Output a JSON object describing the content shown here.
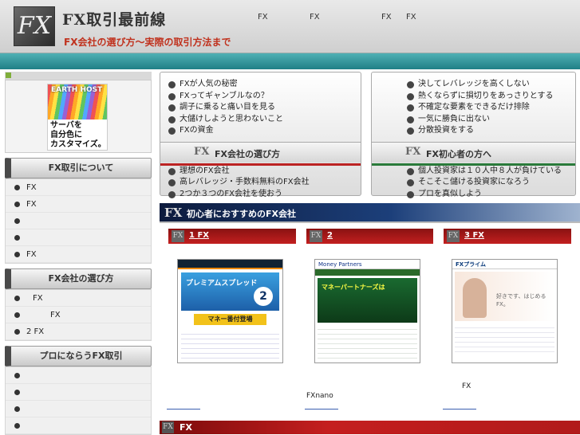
{
  "header": {
    "logo_mark": "FX",
    "title": "FX取引最前線",
    "subtitle": "FX会社の選び方〜実際の取引方法まで",
    "nav": [
      "FX",
      "FX",
      "FX",
      "FX"
    ]
  },
  "sidebar": {
    "ad": {
      "brand": "EARTH HOST",
      "line1": "サーバを",
      "line2": "自分色に",
      "line3": "カスタマイズ。"
    },
    "sections": [
      {
        "title": "FX取引について",
        "items": [
          "FX",
          "FX",
          "",
          "",
          "FX"
        ]
      },
      {
        "title": "FX会社の選び方",
        "items": [
          "FX",
          "FX",
          "2 FX"
        ]
      },
      {
        "title": "プロにならうFX取引",
        "items": [
          "",
          "",
          "",
          ""
        ]
      }
    ]
  },
  "box_left": {
    "top_items": [
      "FXが人気の秘密",
      "FXってギャンブルなの？",
      "調子に乗ると痛い目を見る",
      "大儲けしようと思わないこと",
      "FXの資金"
    ],
    "band_title": "FX会社の選び方",
    "bottom_items": [
      "理想のFX会社",
      "高レバレッジ・手数料無料のFX会社",
      "2つか３つのFX会社を使おう"
    ]
  },
  "box_right": {
    "top_items": [
      "決してレバレッジを高くしない",
      "熱くならずに損切りをあっさりとする",
      "不確定な要素をできるだけ排除",
      "一気に勝負に出ない",
      "分散投資をする"
    ],
    "band_title": "FX初心者の方へ",
    "bottom_items": [
      "個人投資家は１０人中８人が負けている",
      "そこそこ儲ける投資家になろう",
      "プロを真似しよう"
    ]
  },
  "recommend": {
    "title": "初心者におすすめのFX会社",
    "ranks": [
      {
        "label": "1 FX",
        "caption": ""
      },
      {
        "label": "2",
        "caption": "FXnano"
      },
      {
        "label": "3 FX",
        "caption": "FX"
      }
    ],
    "shot_texts": {
      "s1_promo": "プレミアムスプレッド",
      "s1_badge": "2",
      "s1_banner": "マネー番付登場",
      "s2_logo": "Money Partners",
      "s2_promo": "マネーパートナーズは",
      "s3_logo": "FXプライム",
      "s3_tagline": "好きです、はじめるFX。"
    }
  },
  "bottom_bar": {
    "title": "FX"
  },
  "colors": {
    "teal": "#2a8e94",
    "accent_red": "#c0321e",
    "banner_navy": "#1c3f7a"
  }
}
